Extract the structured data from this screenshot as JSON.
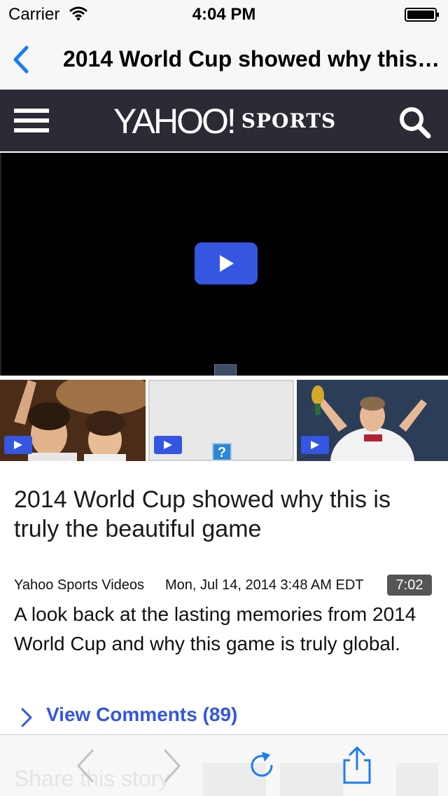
{
  "status_bar": {
    "carrier": "Carrier",
    "time": "4:04 PM"
  },
  "nav_bar": {
    "title": "2014 World Cup showed why this is truly the beautiful game"
  },
  "yahoo_header": {
    "logo_word": "YAHOO!",
    "section": "SPORTS"
  },
  "article": {
    "title": "2014 World Cup showed why this is truly the beautiful game",
    "source": "Yahoo Sports Videos",
    "date": "Mon, Jul 14, 2014 3:48 AM EDT",
    "duration": "7:02",
    "summary": "A look back at the lasting memories from 2014 World Cup and why this game is truly global.",
    "comments_label": "View Comments (89)"
  },
  "thumbnail_placeholder": "?",
  "toolbar": {
    "ghost_text": "Share this story"
  },
  "colors": {
    "accent": "#3456e0",
    "ios_blue": "#1a7cf2",
    "header_bg": "#2b2b36"
  }
}
